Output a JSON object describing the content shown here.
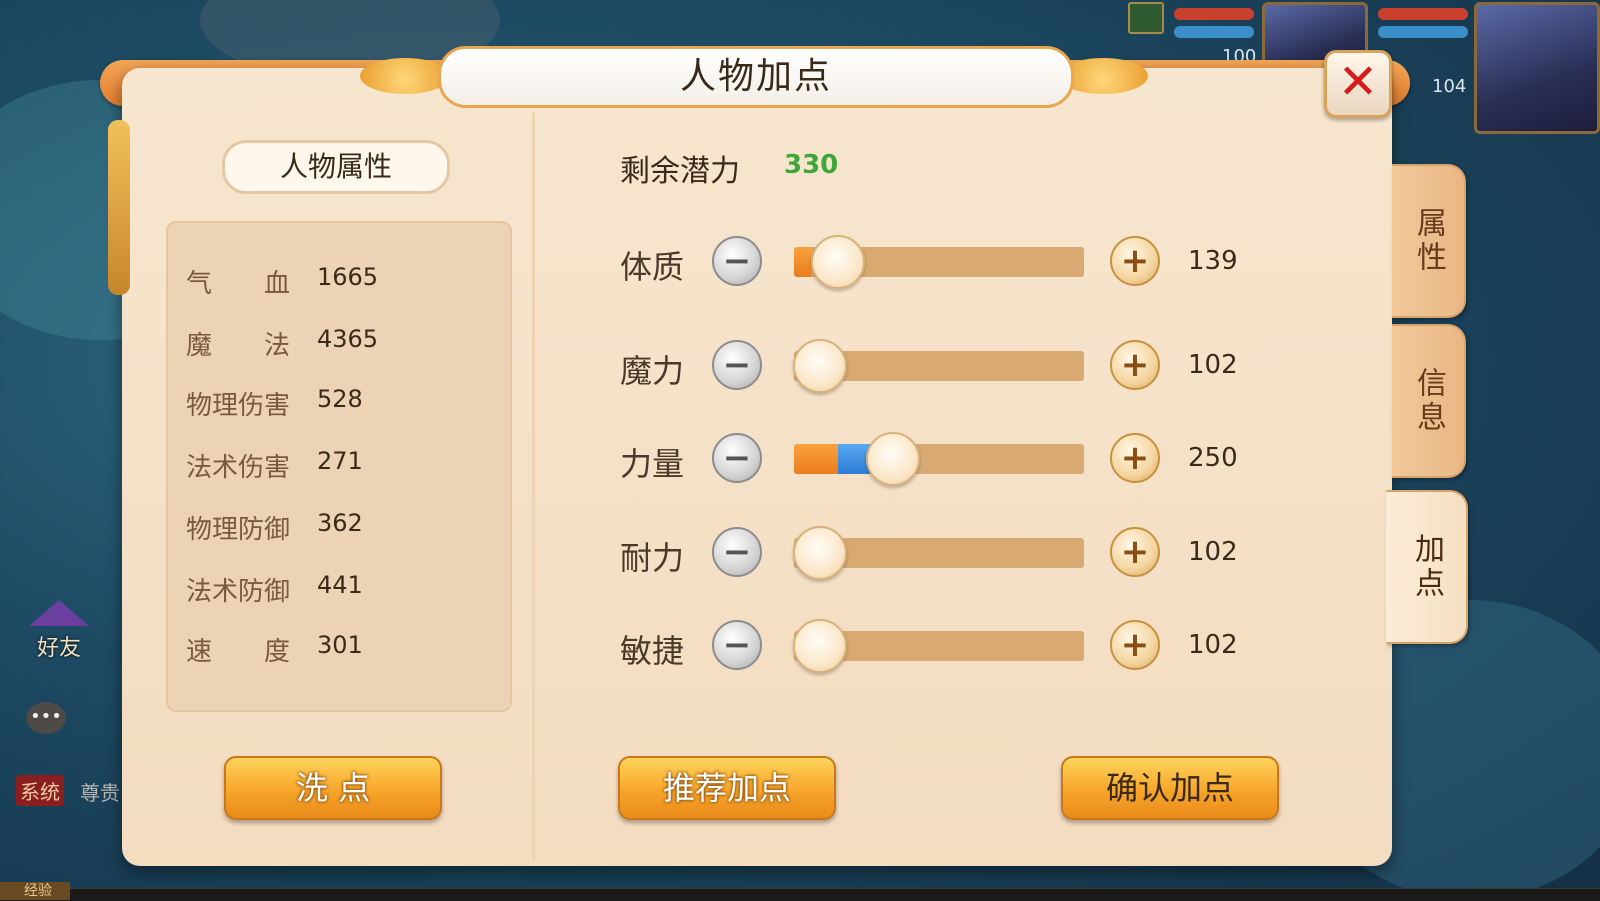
{
  "window": {
    "title": "人物加点",
    "close_icon": "close-icon"
  },
  "hud": {
    "hp_top_left": "100",
    "level": "104"
  },
  "left_panel": {
    "section_title": "人物属性",
    "stats": [
      {
        "label": "气　　血",
        "value": "1665"
      },
      {
        "label": "魔　　法",
        "value": "4365"
      },
      {
        "label": "物理伤害",
        "value": "528"
      },
      {
        "label": "法术伤害",
        "value": "271"
      },
      {
        "label": "物理防御",
        "value": "362"
      },
      {
        "label": "法术防御",
        "value": "441"
      },
      {
        "label": "速　　度",
        "value": "301"
      }
    ],
    "reset_button": "洗 点"
  },
  "right_panel": {
    "potential_label": "剩余潜力",
    "potential_value": "330",
    "attributes": [
      {
        "label": "体质",
        "value": "139",
        "base_fraction": 0.06,
        "added_fraction": 0.0,
        "knob_fraction": 0.15
      },
      {
        "label": "魔力",
        "value": "102",
        "base_fraction": 0.0,
        "added_fraction": 0.0,
        "knob_fraction": 0.09
      },
      {
        "label": "力量",
        "value": "250",
        "base_fraction": 0.15,
        "added_fraction": 0.11,
        "knob_fraction": 0.34
      },
      {
        "label": "耐力",
        "value": "102",
        "base_fraction": 0.0,
        "added_fraction": 0.0,
        "knob_fraction": 0.09
      },
      {
        "label": "敏捷",
        "value": "102",
        "base_fraction": 0.0,
        "added_fraction": 0.0,
        "knob_fraction": 0.09
      }
    ],
    "recommend_button": "推荐加点",
    "confirm_button": "确认加点"
  },
  "side_tabs": [
    {
      "label": "属性",
      "active": false
    },
    {
      "label": "信息",
      "active": false
    },
    {
      "label": "加点",
      "active": true
    }
  ],
  "chat": {
    "friend_label": "好友",
    "system_tag": "系统",
    "system_text": "尊贵",
    "exp_label": "经验"
  },
  "colors": {
    "accent_orange": "#ea7d1e",
    "potential_green": "#3fa73a",
    "added_blue": "#2d7dd6",
    "close_red": "#d81a1a"
  }
}
